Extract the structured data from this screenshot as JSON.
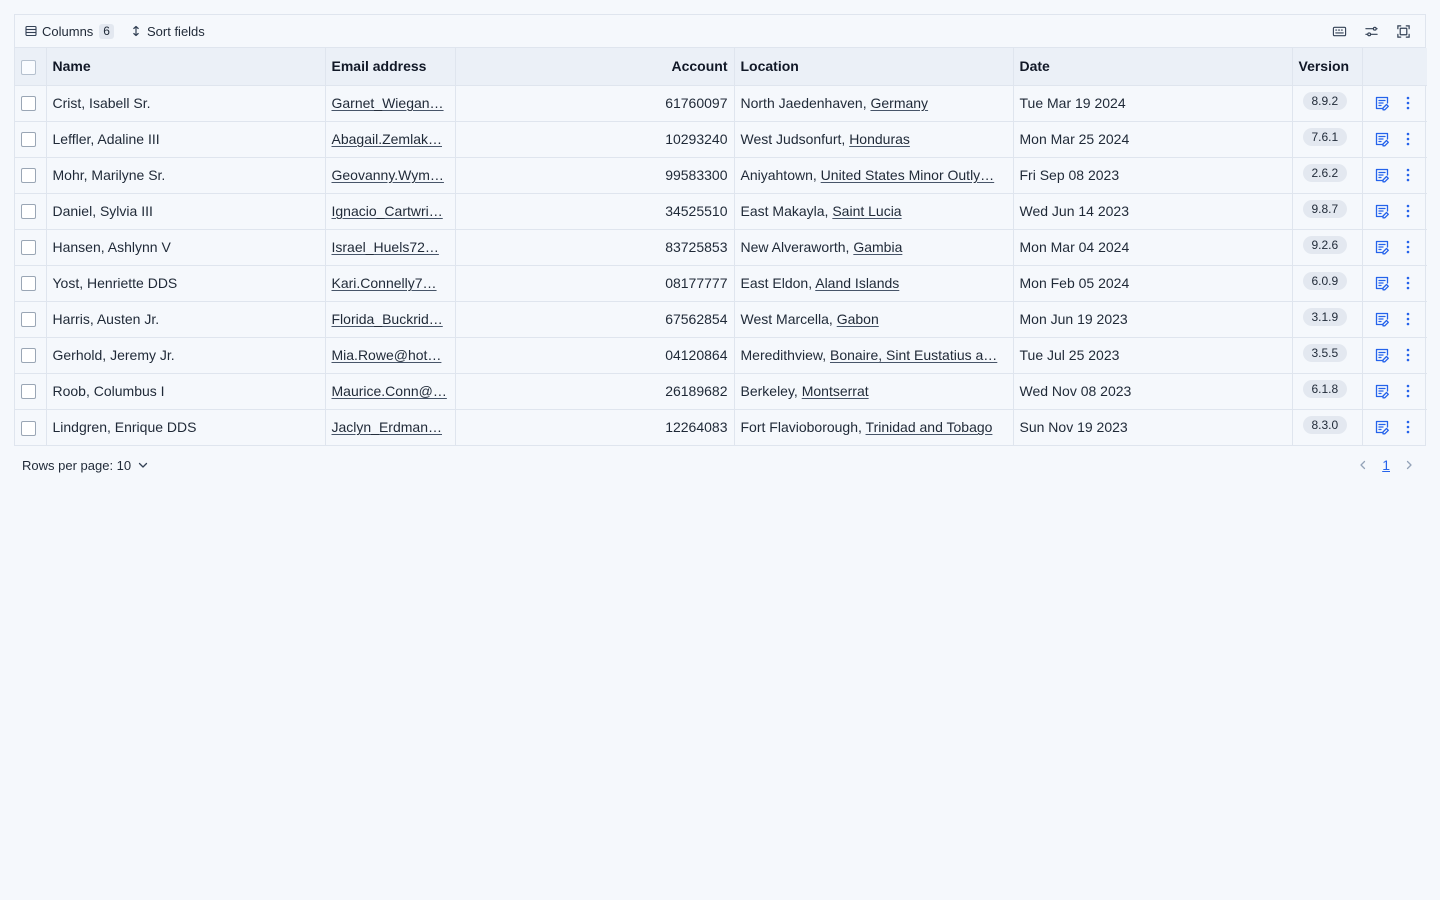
{
  "toolbar": {
    "columns_label": "Columns",
    "columns_count": "6",
    "sort_label": "Sort fields",
    "icons": [
      "keyboard-icon",
      "adjustments-icon",
      "fullscreen-icon"
    ]
  },
  "table": {
    "headers": {
      "name": "Name",
      "email": "Email address",
      "account": "Account",
      "location": "Location",
      "date": "Date",
      "version": "Version"
    },
    "rows": [
      {
        "name": "Crist, Isabell Sr.",
        "email": "Garnet_Wiegan…",
        "account": "61760097",
        "city": "North Jaedenhaven,",
        "country": "Germany",
        "date": "Tue Mar 19 2024",
        "version": "8.9.2"
      },
      {
        "name": "Leffler, Adaline III",
        "email": "Abagail.Zemlak…",
        "account": "10293240",
        "city": "West Judsonfurt,",
        "country": "Honduras",
        "date": "Mon Mar 25 2024",
        "version": "7.6.1"
      },
      {
        "name": "Mohr, Marilyne Sr.",
        "email": "Geovanny.Wym…",
        "account": "99583300",
        "city": "Aniyahtown,",
        "country": "United States Minor Outly…",
        "date": "Fri Sep 08 2023",
        "version": "2.6.2"
      },
      {
        "name": "Daniel, Sylvia III",
        "email": "Ignacio_Cartwri…",
        "account": "34525510",
        "city": "East Makayla,",
        "country": "Saint Lucia",
        "date": "Wed Jun 14 2023",
        "version": "9.8.7"
      },
      {
        "name": "Hansen, Ashlynn V",
        "email": "Israel_Huels72…",
        "account": "83725853",
        "city": "New Alveraworth,",
        "country": "Gambia",
        "date": "Mon Mar 04 2024",
        "version": "9.2.6"
      },
      {
        "name": "Yost, Henriette DDS",
        "email": "Kari.Connelly7…",
        "account": "08177777",
        "city": "East Eldon,",
        "country": "Aland Islands",
        "date": "Mon Feb 05 2024",
        "version": "6.0.9"
      },
      {
        "name": "Harris, Austen Jr.",
        "email": "Florida_Buckrid…",
        "account": "67562854",
        "city": "West Marcella,",
        "country": "Gabon",
        "date": "Mon Jun 19 2023",
        "version": "3.1.9"
      },
      {
        "name": "Gerhold, Jeremy Jr.",
        "email": "Mia.Rowe@hot…",
        "account": "04120864",
        "city": "Meredithview,",
        "country": "Bonaire, Sint Eustatius a…",
        "date": "Tue Jul 25 2023",
        "version": "3.5.5"
      },
      {
        "name": "Roob, Columbus I",
        "email": "Maurice.Conn@…",
        "account": "26189682",
        "city": "Berkeley,",
        "country": "Montserrat",
        "date": "Wed Nov 08 2023",
        "version": "6.1.8"
      },
      {
        "name": "Lindgren, Enrique DDS",
        "email": "Jaclyn_Erdman…",
        "account": "12264083",
        "city": "Fort Flavioborough,",
        "country": "Trinidad and Tobago",
        "date": "Sun Nov 19 2023",
        "version": "8.3.0"
      }
    ]
  },
  "footer": {
    "rows_per_page_label": "Rows per page: 10",
    "current_page": "1"
  },
  "colors": {
    "accent": "#2563eb",
    "background": "#f5f8fc",
    "header_bg": "#ebf0f7",
    "border": "#dfe5ee"
  }
}
